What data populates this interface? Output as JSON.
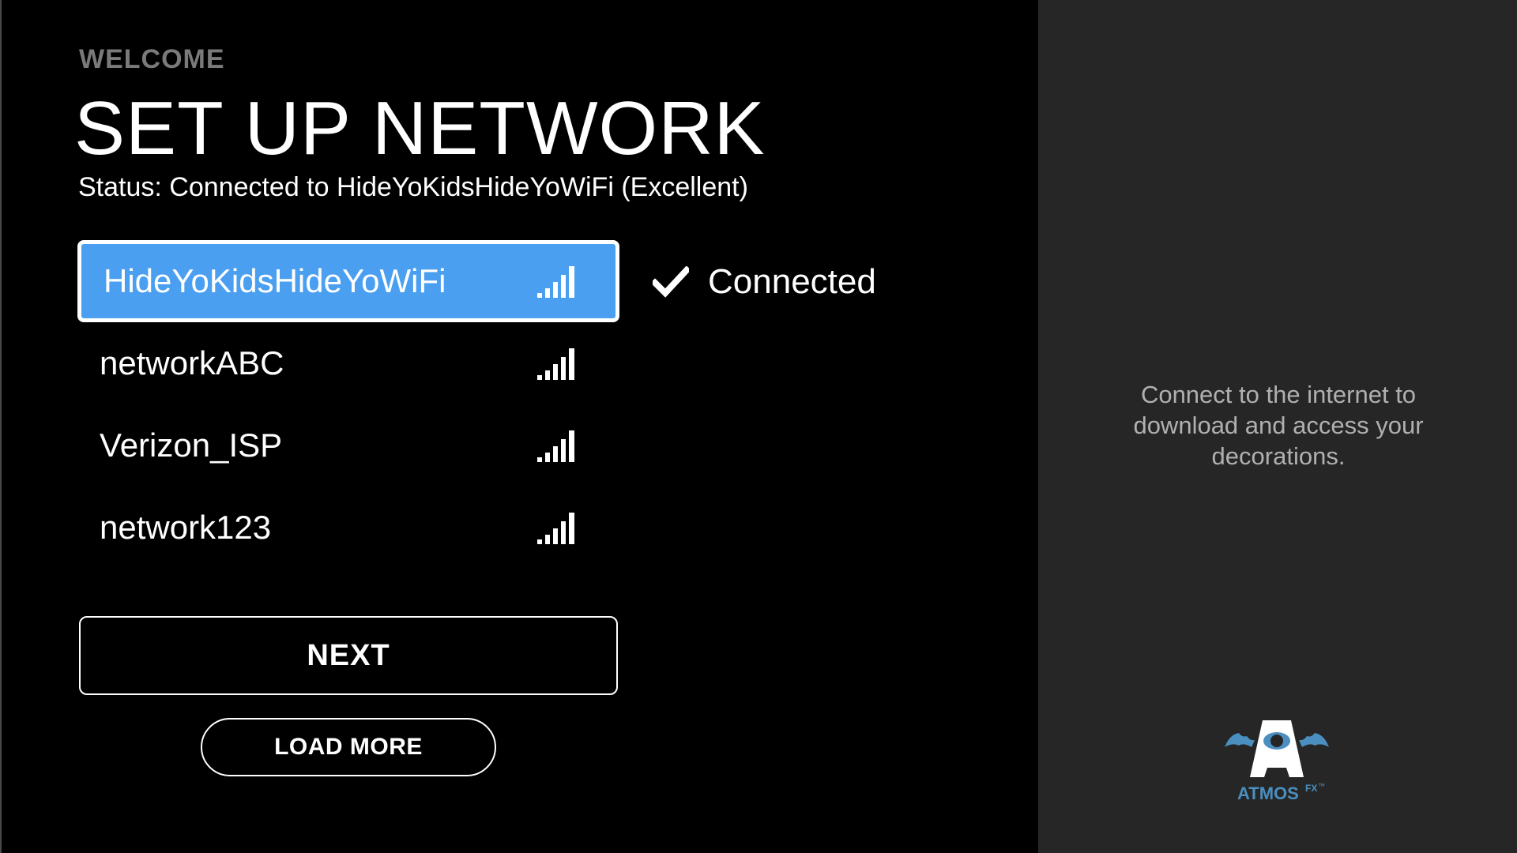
{
  "header": {
    "eyebrow": "WELCOME",
    "title": "SET UP NETWORK",
    "status": "Status: Connected to HideYoKidsHideYoWiFi (Excellent)"
  },
  "networks": [
    {
      "name": "HideYoKidsHideYoWiFi",
      "signal_bars": 5,
      "selected": true
    },
    {
      "name": "networkABC",
      "signal_bars": 5,
      "selected": false
    },
    {
      "name": "Verizon_ISP",
      "signal_bars": 5,
      "selected": false
    },
    {
      "name": "network123",
      "signal_bars": 5,
      "selected": false
    }
  ],
  "connection": {
    "label": "Connected",
    "icon": "checkmark-icon"
  },
  "buttons": {
    "next_label": "NEXT",
    "load_more_label": "LOAD MORE"
  },
  "side_panel": {
    "message": "Connect to the internet to download and access your decorations.",
    "logo_text": "ATMOS",
    "logo_superscript": "FX",
    "logo_trademark": "™"
  },
  "colors": {
    "background": "#000000",
    "side_panel": "#262626",
    "selected_row": "#4a9ff0",
    "text": "#ffffff",
    "muted_text": "#7a7a7a",
    "side_text": "#b0b0b0",
    "logo_accent": "#4a8fc0"
  }
}
